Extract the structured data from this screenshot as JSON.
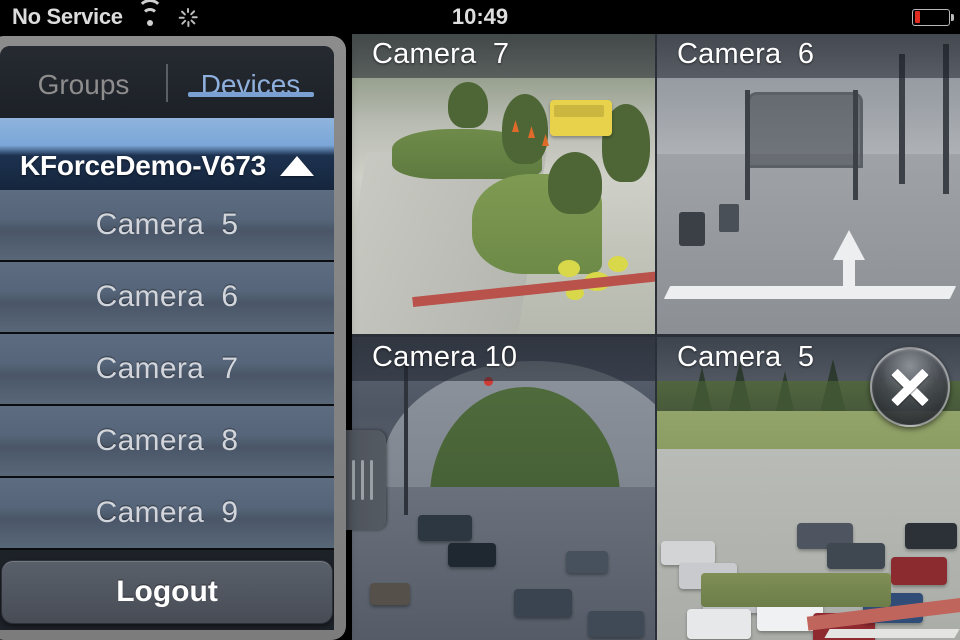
{
  "statusbar": {
    "carrier": "No Service",
    "time": "10:49",
    "wifi_icon": "wifi-icon",
    "activity_icon": "activity-spinner-icon",
    "battery_icon": "battery-low-icon",
    "battery_color": "#e02b20"
  },
  "sidebar": {
    "tabs": [
      {
        "label": "Groups",
        "active": false
      },
      {
        "label": "Devices",
        "active": true
      }
    ],
    "accent_color": "#7ba0d4",
    "device": {
      "name": "KForceDemo-V673",
      "caret_icon": "triangle-up-icon",
      "expanded": true
    },
    "cameras": [
      {
        "label": "Camera  5"
      },
      {
        "label": "Camera  6"
      },
      {
        "label": "Camera  7"
      },
      {
        "label": "Camera  8"
      },
      {
        "label": "Camera  9"
      }
    ],
    "logout_label": "Logout",
    "drag_handle_icon": "drag-handle-icon"
  },
  "grid": {
    "cells": [
      {
        "label": "Camera  7",
        "selected": false,
        "position": "top-left"
      },
      {
        "label": "Camera  6",
        "selected": false,
        "position": "top-right"
      },
      {
        "label": "Camera 10",
        "selected": false,
        "position": "bottom-left"
      },
      {
        "label": "Camera  5",
        "selected": true,
        "position": "bottom-right"
      }
    ],
    "selection_color": "#6f9fd8",
    "close_icon": "close-x-icon"
  }
}
